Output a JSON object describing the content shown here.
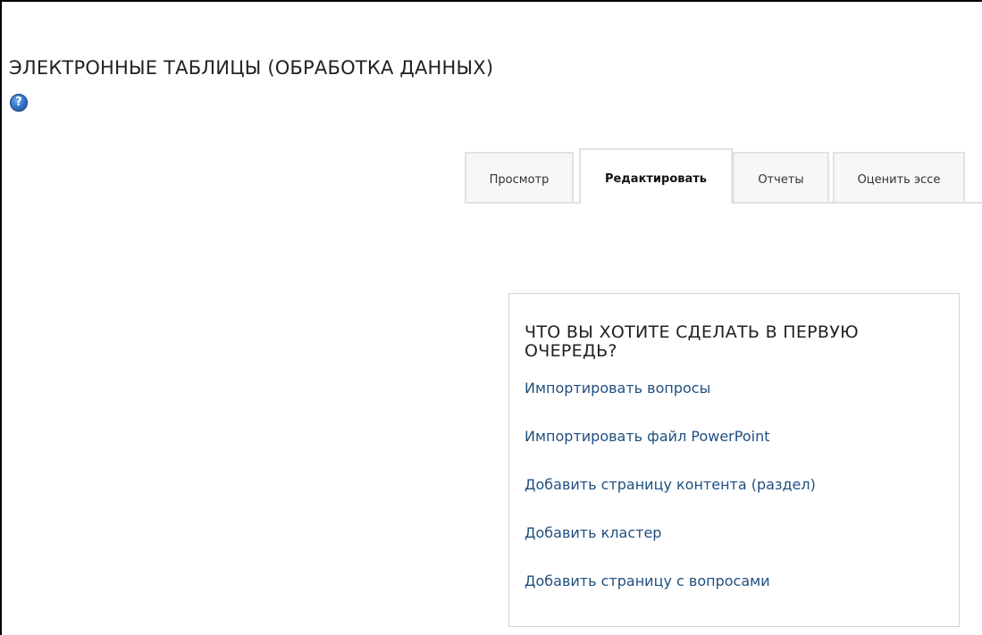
{
  "page": {
    "title": "ЭЛЕКТРОННЫЕ ТАБЛИЦЫ (ОБРАБОТКА ДАННЫХ)",
    "help_icon": "help-question-icon",
    "help_glyph": "?"
  },
  "tabs": [
    {
      "label": "Просмотр",
      "active": false
    },
    {
      "label": "Редактировать",
      "active": true
    },
    {
      "label": "Отчеты",
      "active": false
    },
    {
      "label": "Оценить эссе",
      "active": false
    }
  ],
  "panel": {
    "heading": "ЧТО ВЫ ХОТИТЕ СДЕЛАТЬ В ПЕРВУЮ ОЧЕРЕДЬ?",
    "links": [
      {
        "label": "Импортировать вопросы"
      },
      {
        "label": "Импортировать файл PowerPoint"
      },
      {
        "label": "Добавить страницу контента (раздел)"
      },
      {
        "label": "Добавить кластер"
      },
      {
        "label": "Добавить страницу с вопросами"
      }
    ]
  },
  "colors": {
    "link": "#1f4f7f",
    "tab_border": "#e2e2e2",
    "panel_border": "#d4d4d4",
    "help_icon": "#2f6fc4"
  }
}
